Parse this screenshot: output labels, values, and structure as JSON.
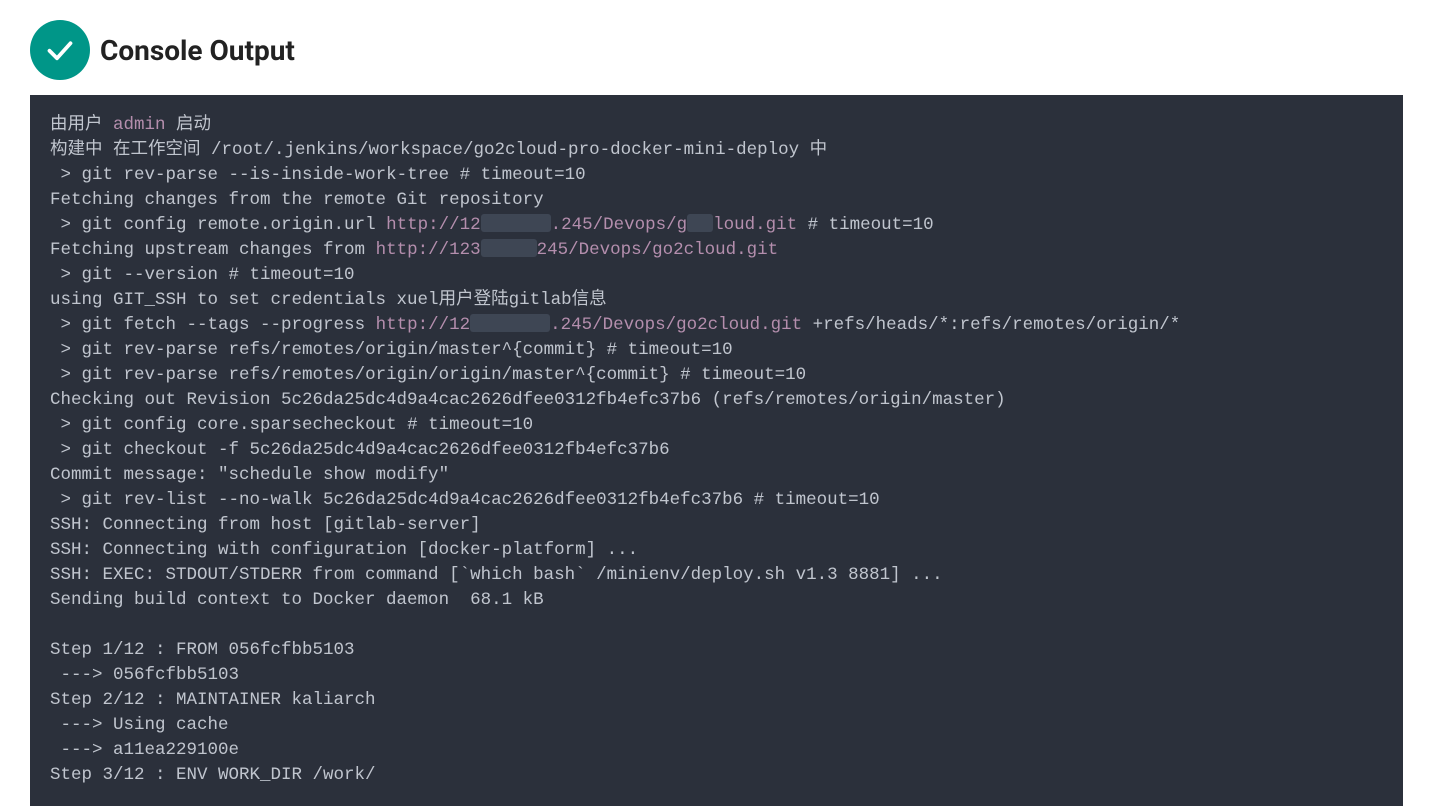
{
  "header": {
    "title": "Console Output"
  },
  "console": {
    "lines": [
      {
        "type": "mixed",
        "parts": [
          {
            "text": "由用户 "
          },
          {
            "text": "admin",
            "cls": "user"
          },
          {
            "text": " 启动"
          }
        ]
      },
      {
        "type": "plain",
        "text": "构建中 在工作空间 /root/.jenkins/workspace/go2cloud-pro-docker-mini-deploy 中"
      },
      {
        "type": "plain",
        "text": " > git rev-parse --is-inside-work-tree # timeout=10"
      },
      {
        "type": "plain",
        "text": "Fetching changes from the remote Git repository"
      },
      {
        "type": "mixed",
        "parts": [
          {
            "text": " > git config remote.origin.url "
          },
          {
            "text": "http://12",
            "cls": "link"
          },
          {
            "redact": "w1"
          },
          {
            "text": ".245/Devops/g",
            "cls": "link"
          },
          {
            "redact": "w3"
          },
          {
            "text": "loud.git",
            "cls": "link"
          },
          {
            "text": " # timeout=10"
          }
        ]
      },
      {
        "type": "mixed",
        "parts": [
          {
            "text": "Fetching upstream changes from "
          },
          {
            "text": "http://123",
            "cls": "link"
          },
          {
            "redact": "w2"
          },
          {
            "text": "245/Devops/go2cloud.git",
            "cls": "link"
          }
        ]
      },
      {
        "type": "plain",
        "text": " > git --version # timeout=10"
      },
      {
        "type": "plain",
        "text": "using GIT_SSH to set credentials xuel用户登陆gitlab信息"
      },
      {
        "type": "mixed",
        "parts": [
          {
            "text": " > git fetch --tags --progress "
          },
          {
            "text": "http://12",
            "cls": "link"
          },
          {
            "redact": "w4"
          },
          {
            "text": ".245/Devops/go2cloud.git",
            "cls": "link"
          },
          {
            "text": " +refs/heads/*:refs/remotes/origin/*"
          }
        ]
      },
      {
        "type": "plain",
        "text": " > git rev-parse refs/remotes/origin/master^{commit} # timeout=10"
      },
      {
        "type": "plain",
        "text": " > git rev-parse refs/remotes/origin/origin/master^{commit} # timeout=10"
      },
      {
        "type": "plain",
        "text": "Checking out Revision 5c26da25dc4d9a4cac2626dfee0312fb4efc37b6 (refs/remotes/origin/master)"
      },
      {
        "type": "plain",
        "text": " > git config core.sparsecheckout # timeout=10"
      },
      {
        "type": "plain",
        "text": " > git checkout -f 5c26da25dc4d9a4cac2626dfee0312fb4efc37b6"
      },
      {
        "type": "plain",
        "text": "Commit message: \"schedule show modify\""
      },
      {
        "type": "plain",
        "text": " > git rev-list --no-walk 5c26da25dc4d9a4cac2626dfee0312fb4efc37b6 # timeout=10"
      },
      {
        "type": "plain",
        "text": "SSH: Connecting from host [gitlab-server]"
      },
      {
        "type": "plain",
        "text": "SSH: Connecting with configuration [docker-platform] ..."
      },
      {
        "type": "plain",
        "text": "SSH: EXEC: STDOUT/STDERR from command [`which bash` /minienv/deploy.sh v1.3 8881] ..."
      },
      {
        "type": "plain",
        "text": "Sending build context to Docker daemon  68.1 kB"
      },
      {
        "type": "plain",
        "text": ""
      },
      {
        "type": "plain",
        "text": "Step 1/12 : FROM 056fcfbb5103"
      },
      {
        "type": "plain",
        "text": " ---> 056fcfbb5103"
      },
      {
        "type": "plain",
        "text": "Step 2/12 : MAINTAINER kaliarch"
      },
      {
        "type": "plain",
        "text": " ---> Using cache"
      },
      {
        "type": "plain",
        "text": " ---> a11ea229100e"
      },
      {
        "type": "plain",
        "text": "Step 3/12 : ENV WORK_DIR /work/"
      }
    ]
  }
}
